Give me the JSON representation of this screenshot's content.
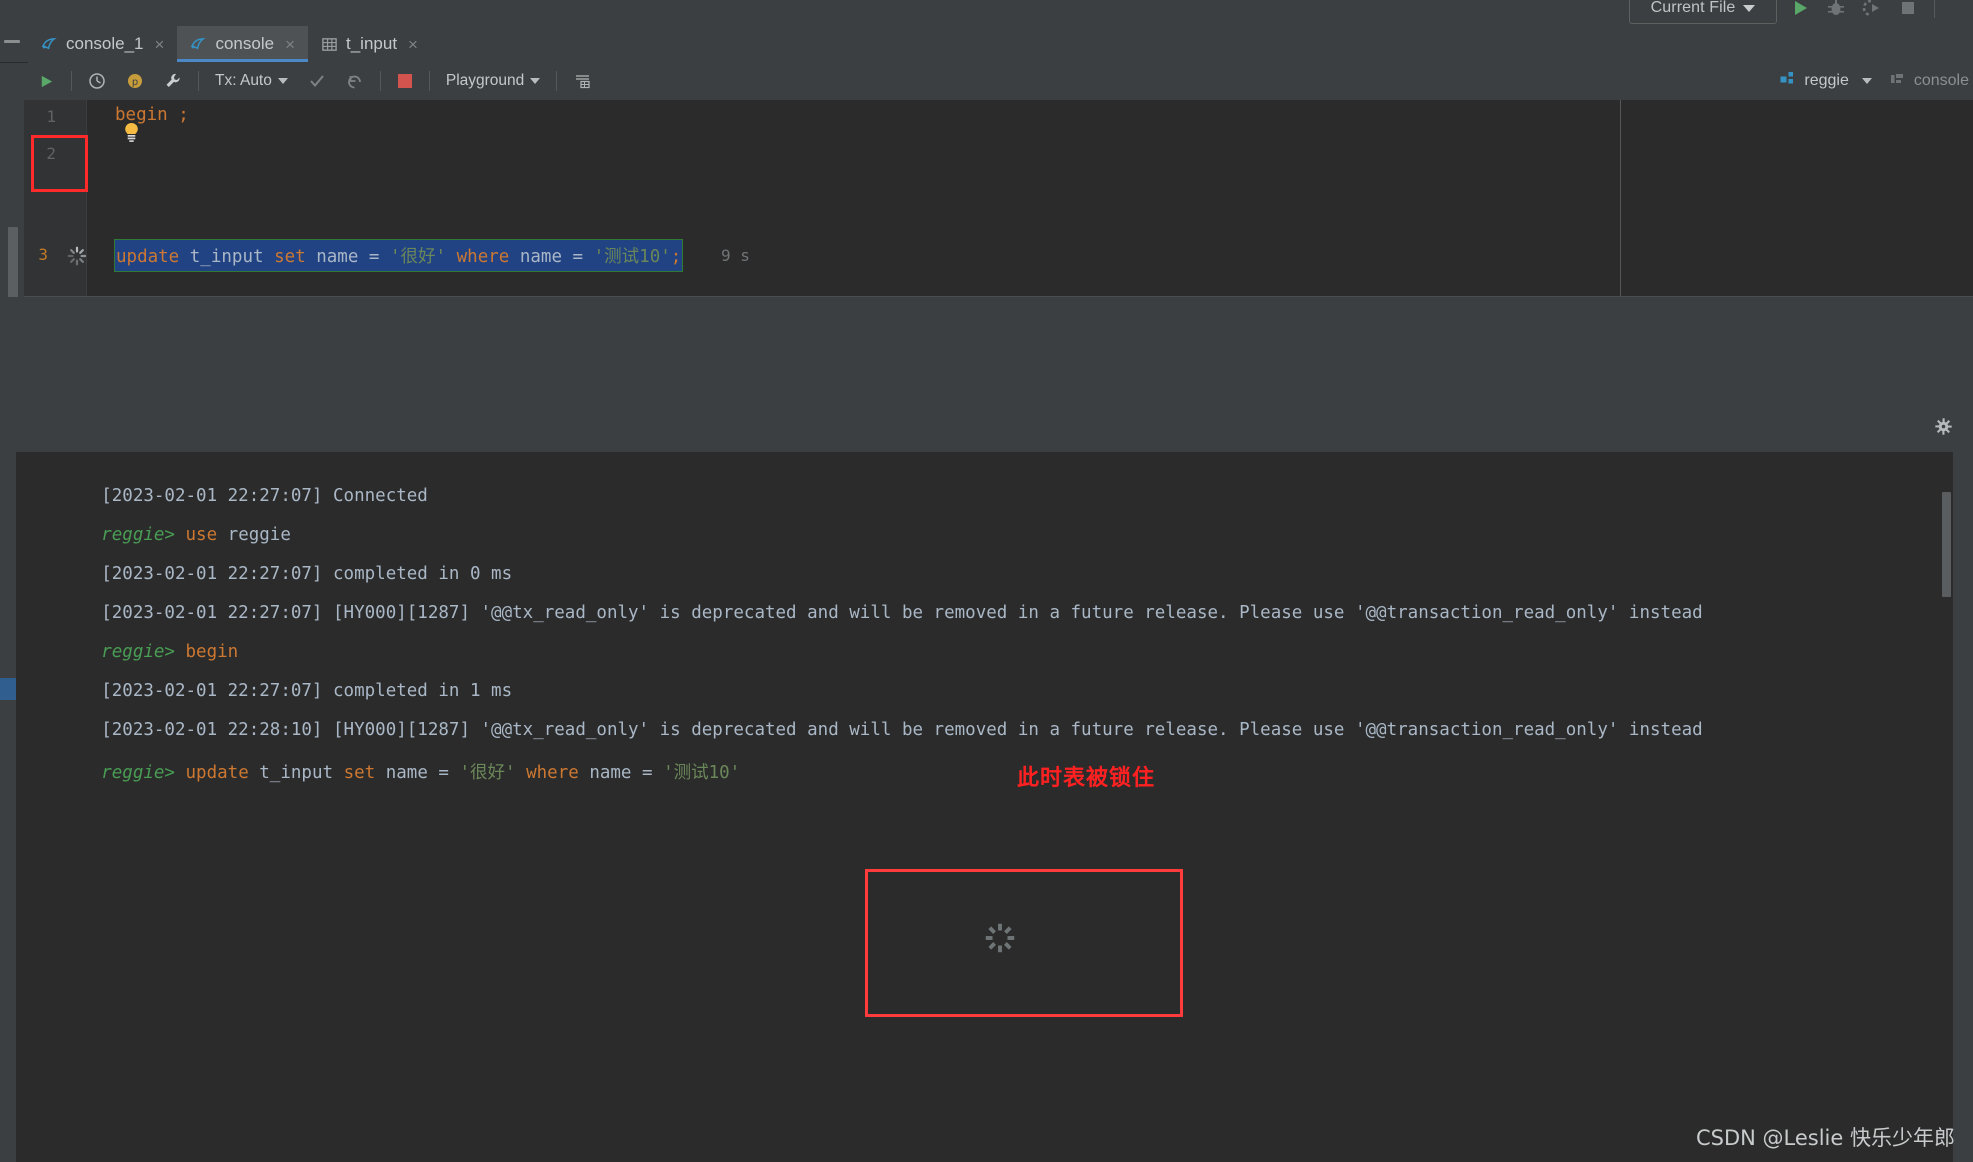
{
  "window": {
    "run_config": {
      "label": "Current File",
      "icon": "chevron-down-icon"
    },
    "top_icons": [
      "run-icon",
      "debug-icon",
      "run-with-coverage-icon",
      "stop-icon"
    ]
  },
  "tabs": [
    {
      "label": "console_1",
      "icon": "mysql-console-icon",
      "close": "×",
      "active": false
    },
    {
      "label": "console",
      "icon": "mysql-console-icon",
      "close": "×",
      "active": true
    },
    {
      "label": "t_input",
      "icon": "table-icon",
      "close": "×",
      "active": false
    }
  ],
  "editor_toolbar": {
    "execute_label": "",
    "tx_label": "Tx: Auto",
    "schema_label": "Playground",
    "icons": [
      "execute-icon",
      "history-icon",
      "p-badge-icon",
      "wrench-icon",
      "commit-icon",
      "rollback-icon",
      "stop-icon",
      "table-grid-icon"
    ],
    "datasource_label": "reggie",
    "session_label": "console"
  },
  "editor": {
    "line_numbers": [
      "1",
      "2",
      "3"
    ],
    "current_line": "3",
    "lines": [
      {
        "n": "1",
        "tokens": [
          {
            "t": "begin",
            "cls": "kw"
          },
          {
            "t": " ",
            "cls": "plain"
          },
          {
            "t": ";",
            "cls": "kw"
          }
        ]
      },
      {
        "n": "2",
        "tokens": []
      },
      {
        "n": "3",
        "selected": true,
        "tokens": [
          {
            "t": "update",
            "cls": "kw"
          },
          {
            "t": " ",
            "cls": "plain"
          },
          {
            "t": "t_input",
            "cls": "plain"
          },
          {
            "t": " ",
            "cls": "plain"
          },
          {
            "t": "set",
            "cls": "kw"
          },
          {
            "t": " ",
            "cls": "plain"
          },
          {
            "t": "name",
            "cls": "plain"
          },
          {
            "t": " = ",
            "cls": "plain"
          },
          {
            "t": "'很好'",
            "cls": "str"
          },
          {
            "t": " ",
            "cls": "plain"
          },
          {
            "t": "where",
            "cls": "kw"
          },
          {
            "t": " ",
            "cls": "plain"
          },
          {
            "t": "name",
            "cls": "plain"
          },
          {
            "t": " = ",
            "cls": "plain"
          },
          {
            "t": "'测试10'",
            "cls": "str"
          },
          {
            "t": ";",
            "cls": "kw"
          }
        ]
      }
    ],
    "line3_text": "update t_input set name = '很好' where name = '测试10';",
    "elapsed": "9 s",
    "gutter_spinner": "loading-spinner-icon",
    "intention_bulb": "lightbulb-icon"
  },
  "console_output": {
    "gear": "gear-icon",
    "lines": [
      {
        "segments": [
          {
            "t": "[2023-02-01 22:27:07] Connected",
            "cls": "c-ts"
          }
        ]
      },
      {
        "segments": [
          {
            "t": "reggie> ",
            "cls": "c-prompt"
          },
          {
            "t": "use",
            "cls": "c-kw"
          },
          {
            "t": " reggie",
            "cls": "c-txt"
          }
        ]
      },
      {
        "segments": [
          {
            "t": "[2023-02-01 22:27:07] completed in 0 ms",
            "cls": "c-ts"
          }
        ]
      },
      {
        "segments": [
          {
            "t": "[2023-02-01 22:27:07] [HY000][1287] '@@tx_read_only' is deprecated and will be removed in a future release. Please use '@@transaction_read_only' instead",
            "cls": "c-ts"
          }
        ]
      },
      {
        "segments": [
          {
            "t": "reggie> ",
            "cls": "c-prompt"
          },
          {
            "t": "begin",
            "cls": "c-kw"
          }
        ]
      },
      {
        "segments": [
          {
            "t": "[2023-02-01 22:27:07] completed in 1 ms",
            "cls": "c-ts"
          }
        ]
      },
      {
        "segments": [
          {
            "t": "[2023-02-01 22:28:10] [HY000][1287] '@@tx_read_only' is deprecated and will be removed in a future release. Please use '@@transaction_read_only' instead",
            "cls": "c-ts"
          }
        ]
      },
      {
        "segments": [
          {
            "t": "reggie> ",
            "cls": "c-prompt"
          },
          {
            "t": "update",
            "cls": "c-kw"
          },
          {
            "t": " t_input ",
            "cls": "c-txt"
          },
          {
            "t": "set",
            "cls": "c-kw"
          },
          {
            "t": " name = ",
            "cls": "c-txt"
          },
          {
            "t": "'很好'",
            "cls": "c-str"
          },
          {
            "t": " ",
            "cls": "c-txt"
          },
          {
            "t": "where",
            "cls": "c-kw"
          },
          {
            "t": " name = ",
            "cls": "c-txt"
          },
          {
            "t": "'测试10'",
            "cls": "c-str"
          }
        ]
      }
    ]
  },
  "annotations": {
    "text": "此时表被锁住",
    "text_color": "#ff2121",
    "box_color": "#ff3b3b",
    "spinner": "loading-spinner-icon"
  },
  "watermark": {
    "text": "CSDN @Leslie 快乐少年郎"
  },
  "colors": {
    "background": "#3c3f41",
    "editor_bg": "#2b2b2b",
    "gutter_bg": "#313335",
    "selection": "#214283",
    "accent_tab": "#4a88c7",
    "keyword": "#cc7832",
    "string": "#6a8759",
    "prompt_green": "#499c54",
    "annotation_red": "#ff2b2b"
  }
}
